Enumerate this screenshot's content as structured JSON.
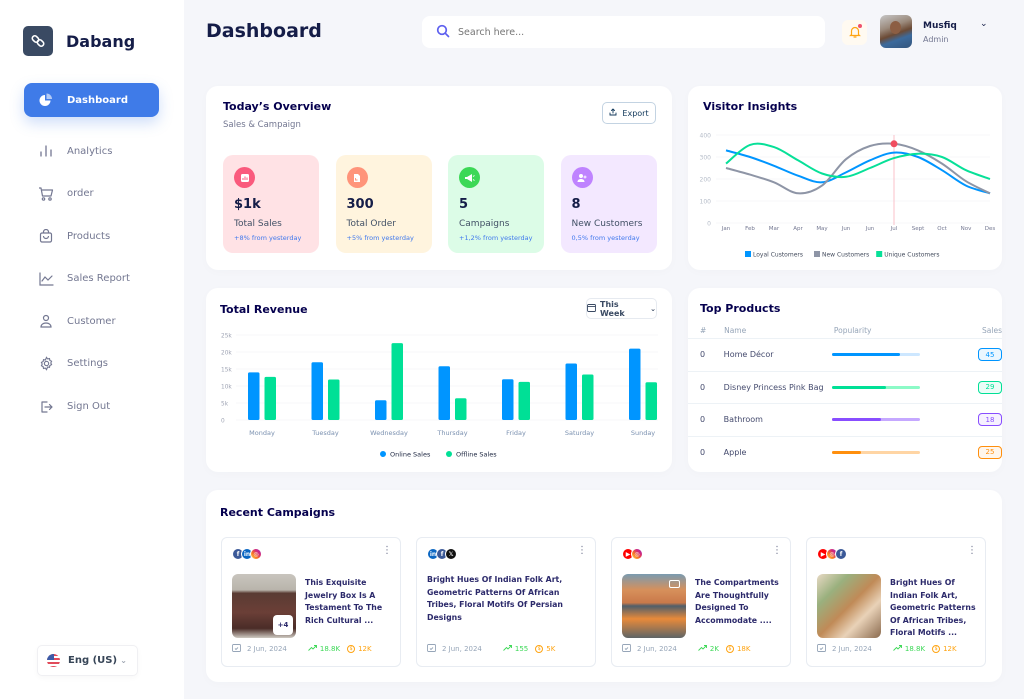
{
  "app": {
    "name": "Dabang",
    "logo_icon": "link-icon"
  },
  "sidebar": {
    "items": [
      {
        "label": "Dashboard",
        "icon": "pie-chart-icon",
        "active": true
      },
      {
        "label": "Analytics",
        "icon": "bar-chart-icon"
      },
      {
        "label": "order",
        "icon": "cart-icon"
      },
      {
        "label": "Products",
        "icon": "shopping-bag-icon"
      },
      {
        "label": "Sales Report",
        "icon": "line-chart-icon"
      },
      {
        "label": "Customer",
        "icon": "user-icon"
      },
      {
        "label": "Settings",
        "icon": "gear-icon"
      },
      {
        "label": "Sign Out",
        "icon": "sign-out-icon"
      }
    ],
    "language": {
      "label": "Eng (US)",
      "icon": "us-flag-icon"
    }
  },
  "header": {
    "title": "Dashboard",
    "search": {
      "placeholder": "Search here...",
      "value": ""
    },
    "notifications": {
      "icon": "bell-icon",
      "has_unread": true
    },
    "user": {
      "name": "Musfiq",
      "role": "Admin"
    }
  },
  "overview": {
    "title": "Today’s Overview",
    "subtitle": "Sales & Campaign",
    "export_label": "Export",
    "stats": [
      {
        "value": "$1k",
        "label": "Total Sales",
        "change": "+8% from yesterday",
        "icon": "chart-icon",
        "bg": "#FFE2E5",
        "icon_bg": "#FA5A7D"
      },
      {
        "value": "300",
        "label": "Total Order",
        "change": "+5% from yesterday",
        "icon": "document-icon",
        "bg": "#FFF4DE",
        "icon_bg": "#FF947A"
      },
      {
        "value": "5",
        "label": "Campaigns",
        "change": "+1,2% from yesterday",
        "icon": "megaphone-icon",
        "bg": "#DCFCE7",
        "icon_bg": "#3CD856"
      },
      {
        "value": "8",
        "label": "New Customers",
        "change": "0,5% from yesterday",
        "icon": "add-user-icon",
        "bg": "#F3E8FF",
        "icon_bg": "#BF83FF"
      }
    ]
  },
  "top_products": {
    "title": "Top Products",
    "columns": [
      "#",
      "Name",
      "Popularity",
      "Sales"
    ],
    "rows": [
      {
        "rank": "0",
        "name": "Home Décor",
        "popularity": 0.78,
        "sales": "45",
        "color": "#0095FF",
        "track": "#CDE7FF"
      },
      {
        "rank": "0",
        "name": "Disney Princess Pink Bag",
        "popularity": 0.62,
        "sales": "29",
        "color": "#00E096",
        "track": "#8CFAC7"
      },
      {
        "rank": "0",
        "name": "Bathroom",
        "popularity": 0.56,
        "sales": "18",
        "color": "#884DFF",
        "track": "#C5A8FF"
      },
      {
        "rank": "0",
        "name": "Apple",
        "popularity": 0.34,
        "sales": "25",
        "color": "#FF8F0D",
        "track": "#FFD5A4"
      }
    ]
  },
  "campaigns": {
    "title": "Recent Campaigns",
    "items": [
      {
        "socials": [
          "facebook",
          "linkedin",
          "instagram"
        ],
        "text": "This Exquisite Jewelry Box Is A Testament To The Rich Cultural ...",
        "has_image": true,
        "image": "jewelry-box",
        "extra_images": "+4",
        "date": "2 Jun, 2024",
        "reach": "18.8K",
        "cost": "12K"
      },
      {
        "socials": [
          "linkedin",
          "facebook",
          "x"
        ],
        "text": "Bright Hues Of Indian Folk Art, Geometric Patterns Of African Tribes, Floral Motifs Of Persian Designs",
        "has_image": false,
        "date": "2 Jun, 2024",
        "reach": "155",
        "cost": "5K"
      },
      {
        "socials": [
          "youtube",
          "instagram"
        ],
        "text": "The Compartments Are Thoughtfully Designed To Accommodate ....",
        "has_image": true,
        "image": "outdoor-building-video",
        "date": "2 Jun, 2024",
        "reach": "2K",
        "cost": "18K"
      },
      {
        "socials": [
          "youtube",
          "instagram",
          "facebook"
        ],
        "text": "Bright Hues Of Indian Folk Art, Geometric Patterns Of African Tribes, Floral Motifs ...",
        "has_image": true,
        "image": "hanging-chair",
        "date": "2 Jun, 2024",
        "reach": "18.8K",
        "cost": "12K"
      }
    ]
  },
  "chart_data": [
    {
      "type": "line",
      "title": "Visitor Insights",
      "x": [
        "Jan",
        "Feb",
        "Mar",
        "Apr",
        "May",
        "Jun",
        "Jun",
        "Jul",
        "Sept",
        "Oct",
        "Nov",
        "Des"
      ],
      "ylim": [
        0,
        400
      ],
      "yticks": [
        0,
        100,
        200,
        300,
        400
      ],
      "grid": true,
      "legend": "bottom",
      "highlight": {
        "series": "New Customers",
        "x": "Jul",
        "value": 360
      },
      "series": [
        {
          "name": "Loyal Customers",
          "color": "#0095FF",
          "values": [
            330,
            300,
            260,
            215,
            185,
            230,
            285,
            320,
            300,
            240,
            170,
            135
          ]
        },
        {
          "name": "New Customers",
          "color": "#8E95A6",
          "values": [
            250,
            220,
            185,
            135,
            170,
            290,
            350,
            360,
            330,
            270,
            190,
            135
          ]
        },
        {
          "name": "Unique Customers",
          "color": "#07E098",
          "values": [
            270,
            355,
            345,
            285,
            225,
            210,
            250,
            295,
            315,
            300,
            240,
            200
          ]
        }
      ]
    },
    {
      "type": "bar",
      "title": "Total Revenue",
      "period_label": "This Week",
      "categories": [
        "Monday",
        "Tuesday",
        "Wednesday",
        "Thursday",
        "Friday",
        "Saturday",
        "Sunday"
      ],
      "ylim": [
        0,
        25000
      ],
      "yticks": [
        "0",
        "5k",
        "10k",
        "15k",
        "20k",
        "25k"
      ],
      "ytick_values": [
        0,
        5000,
        10000,
        15000,
        20000,
        25000
      ],
      "grid": true,
      "legend": "bottom",
      "series": [
        {
          "name": "Online Sales",
          "color": "#0095FF",
          "values": [
            14000,
            17000,
            5800,
            15800,
            12000,
            16600,
            21000
          ]
        },
        {
          "name": "Offline Sales",
          "color": "#00E096",
          "values": [
            12700,
            11900,
            22600,
            6400,
            11200,
            13400,
            11100
          ]
        }
      ]
    }
  ]
}
